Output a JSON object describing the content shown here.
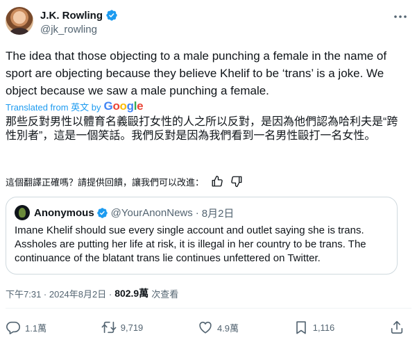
{
  "author": {
    "name": "J.K. Rowling",
    "handle": "@jk_rowling"
  },
  "tweet": {
    "text": "The idea that those objecting to a male punching a female in the name of sport are objecting because they believe Khelif to be ‘trans’ is a joke. We object because we saw a male punching a female.",
    "translated_label": "Translated from 英文 by",
    "translation_provider": "Google",
    "translation": "那些反對男性以體育名義毆打女性的人之所以反對，是因為他們認為哈利夫是“跨性別者”，這是一個笑話。我們反對是因為我們看到一名男性毆打一名女性。",
    "feedback_prompt": "這個翻譯正確嗎？請提供回饋，讓我們可以改進："
  },
  "quote": {
    "name": "Anonymous",
    "handle": "@YourAnonNews",
    "separator": "·",
    "date": "8月2日",
    "text": "Imane Khelif should sue every single account and outlet saying she is trans. Assholes are putting her life at risk, it is illegal in her country to be trans. The continuance of the blatant trans lie continues unfettered on Twitter."
  },
  "meta": {
    "timestamp": "下午7:31 · 2024年8月2日 ·",
    "views": "802.9萬",
    "views_label": "次查看"
  },
  "actions": {
    "replies": "1.1萬",
    "retweets": "9,719",
    "likes": "4.9萬",
    "bookmarks": "1,116"
  },
  "colors": {
    "accent": "#1d9bf0",
    "text": "#0f1419",
    "secondary": "#536471",
    "border": "#cfd9de"
  },
  "icons": [
    "verified-badge-icon",
    "more-icon",
    "thumbs-up-icon",
    "thumbs-down-icon",
    "reply-icon",
    "retweet-icon",
    "like-icon",
    "bookmark-icon",
    "share-icon"
  ]
}
